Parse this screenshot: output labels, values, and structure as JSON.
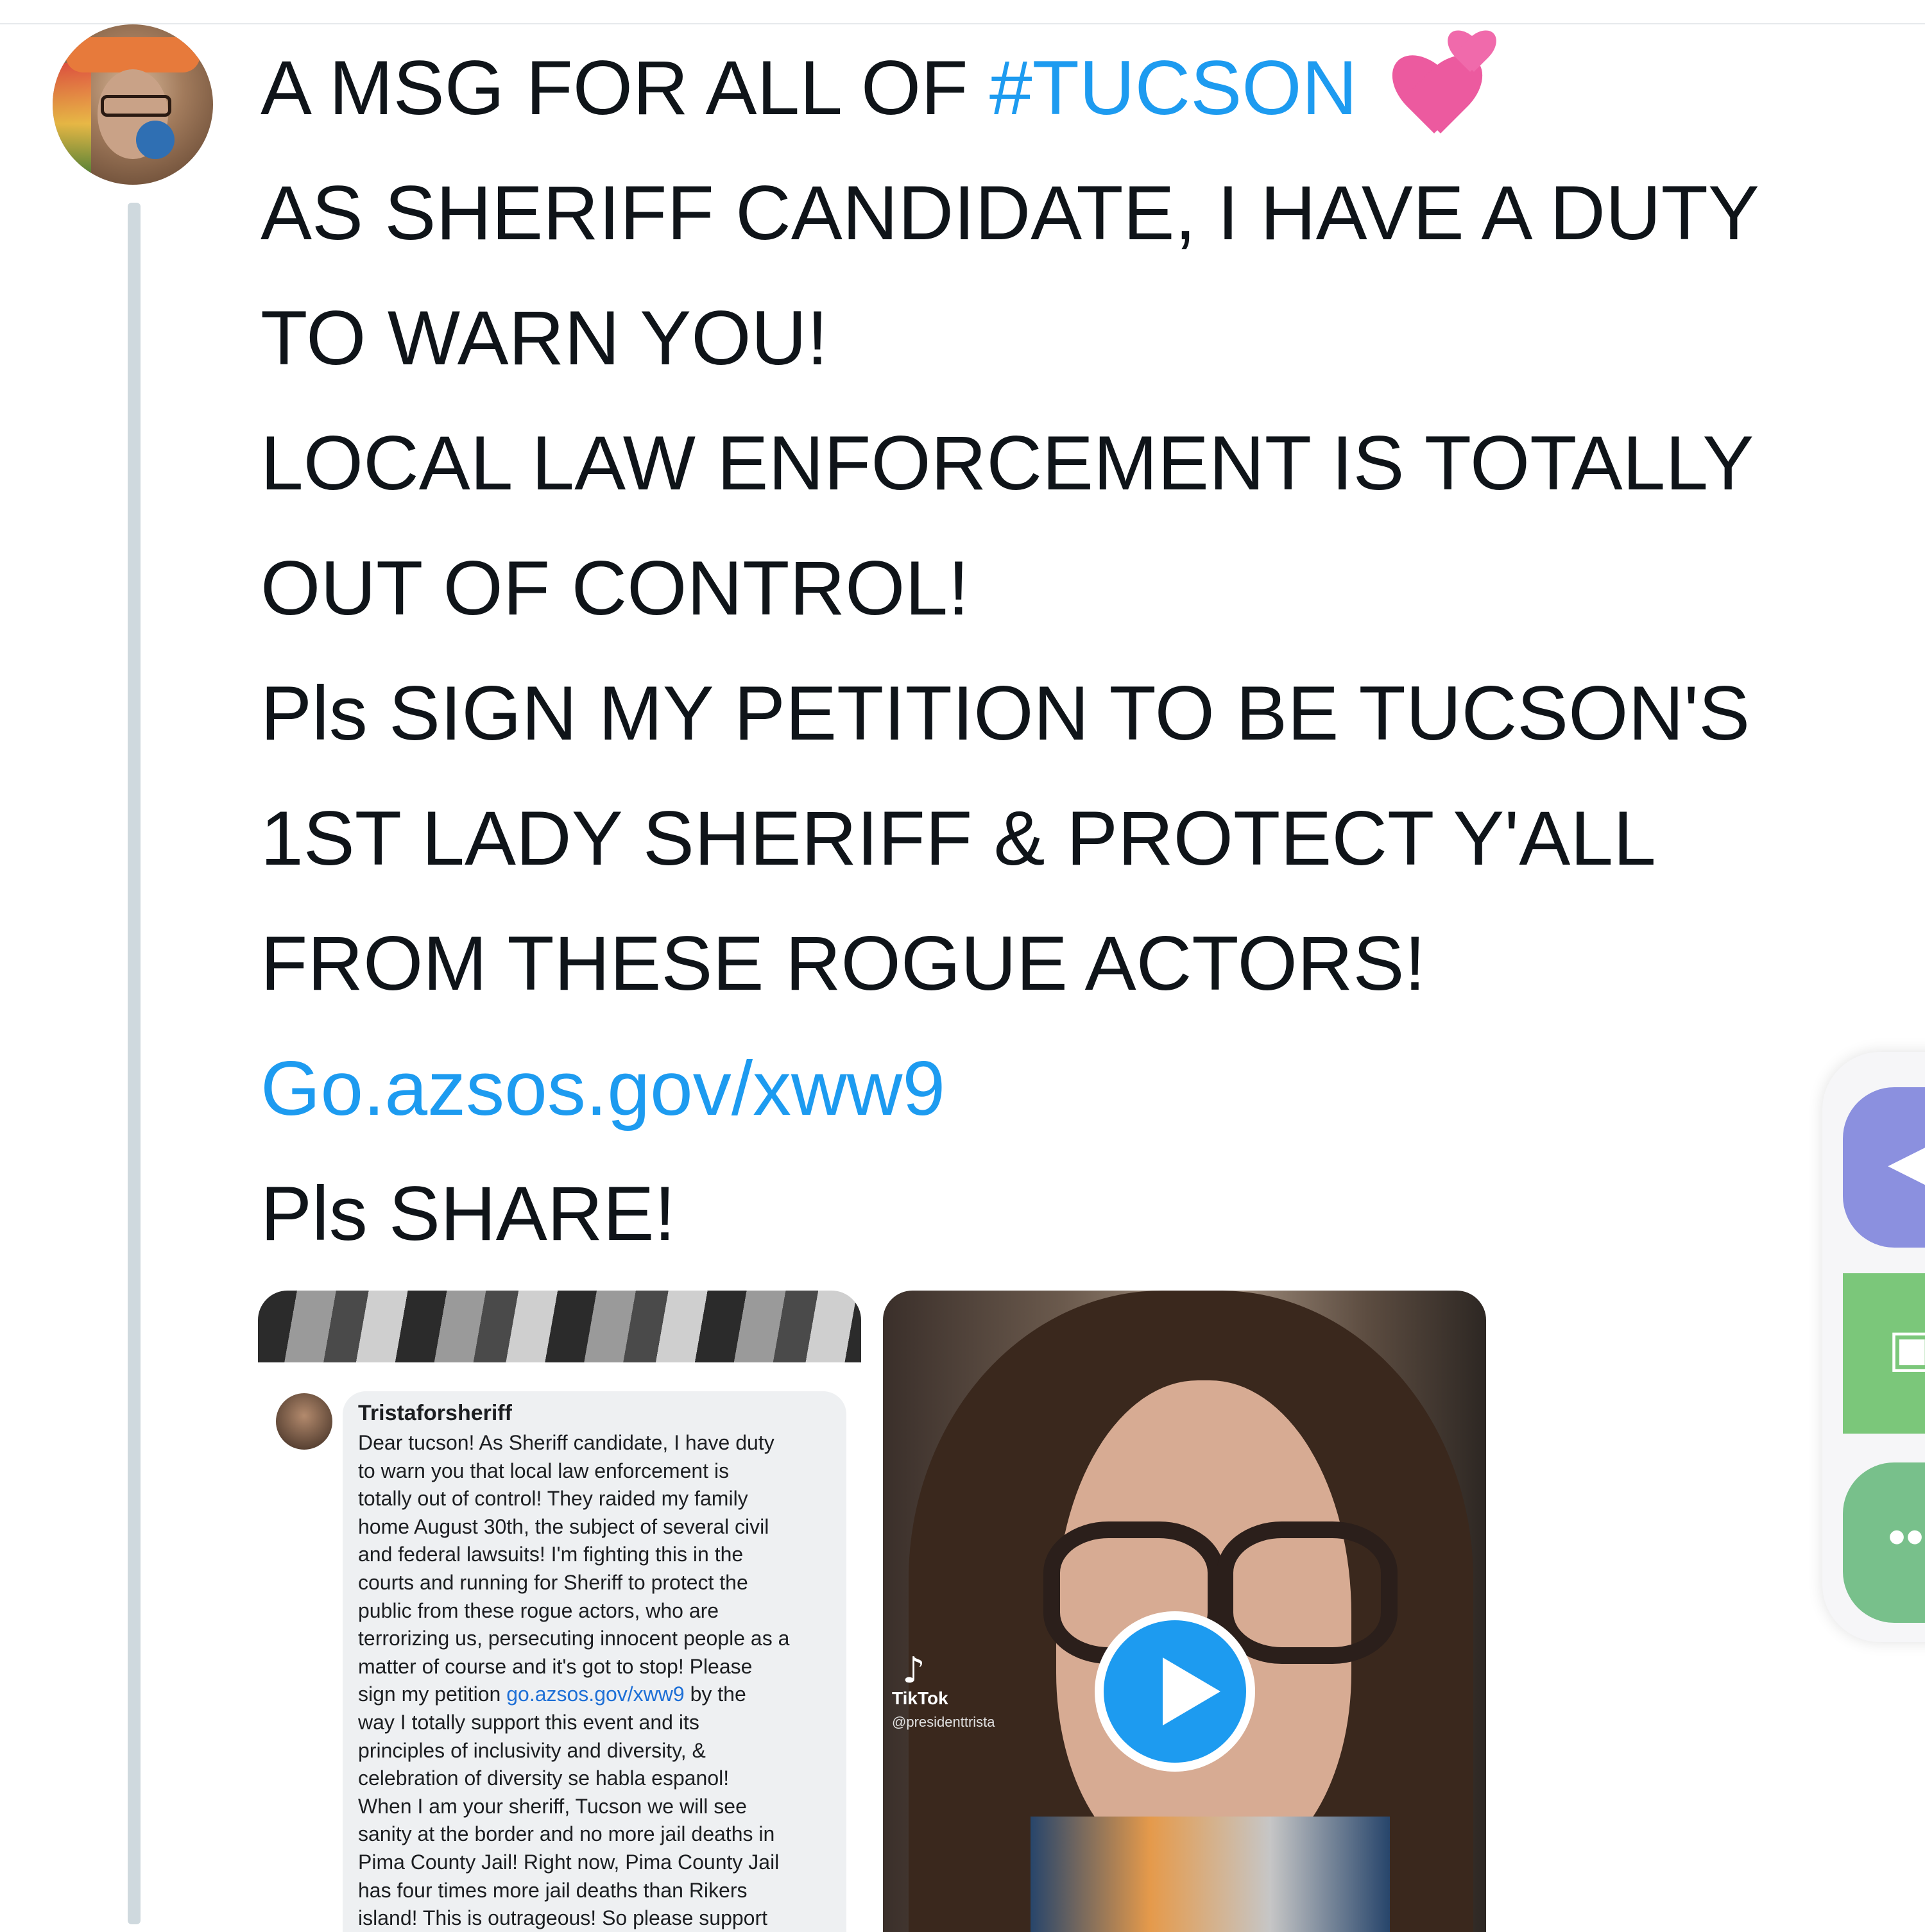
{
  "tweet": {
    "lines": [
      {
        "text": "A MSG FOR ALL OF "
      },
      {
        "text": "AS SHERIFF CANDIDATE, I HAVE A DUTY"
      },
      {
        "text": "TO WARN YOU!"
      },
      {
        "text": "LOCAL LAW ENFORCEMENT IS TOTALLY"
      },
      {
        "text": "OUT OF CONTROL!"
      },
      {
        "text": "Pls SIGN MY PETITION TO BE TUCSON'S"
      },
      {
        "text": "1ST LADY SHERIFF & PROTECT Y'ALL"
      },
      {
        "text": "FROM THESE ROGUE ACTORS!"
      },
      {
        "text": "Go.azsos.gov/xww9"
      },
      {
        "text": "Pls SHARE!"
      }
    ],
    "hashtag": "#TUCSON",
    "emoji": "two-hearts-icon",
    "link_color": "#1d9bf0"
  },
  "embedded_post": {
    "author": "Tristaforsheriff",
    "body_lines": [
      "Dear tucson! As Sheriff candidate, I have duty",
      "to warn you that local law enforcement is",
      "totally out of control! They raided my family",
      "home August 30th,  the subject of several civil",
      "and federal lawsuits! I'm fighting this in the",
      "courts and running for Sheriff to protect the",
      "public from these rogue actors, who are",
      "terrorizing us, persecuting innocent people as a",
      "matter of course and it's got to stop! Please",
      "way I totally support this event and its",
      "principles of inclusivity and diversity, &",
      "celebration of diversity se habla espanol!",
      "When I am your sheriff, Tucson we will see",
      "sanity at the border and no more jail deaths in",
      "Pima County Jail! Right now, Pima County Jail",
      "has four times more jail deaths than Rikers",
      "island! This is outrageous! So please support"
    ],
    "petition_prefix": "sign my petition ",
    "petition_link": "go.azsos.gov/xww9",
    "petition_suffix": " by the"
  },
  "video": {
    "tiktok_label": "TikTok",
    "tiktok_handle": "@presidenttrista",
    "play_icon": "play-icon"
  },
  "side_panel": {
    "icons": [
      "speaker-icon",
      "puzzle-icon",
      "more-icon"
    ]
  }
}
